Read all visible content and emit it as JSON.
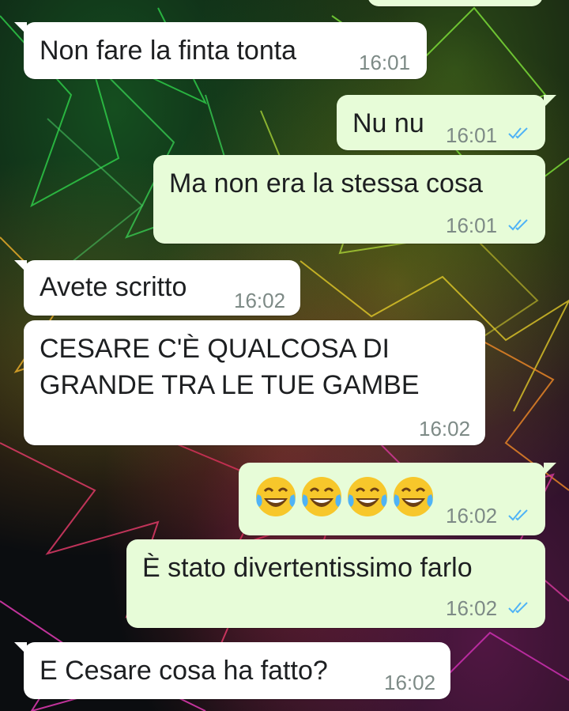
{
  "messages": [
    {
      "text": "Non fare la finta tonta",
      "time": "16:01",
      "dir": "in"
    },
    {
      "text": "Nu nu",
      "time": "16:01",
      "dir": "out",
      "read": true
    },
    {
      "text": "Ma non era la stessa cosa",
      "time": "16:01",
      "dir": "out",
      "read": true
    },
    {
      "text": "Avete scritto",
      "time": "16:02",
      "dir": "in"
    },
    {
      "text_line1": "CESARE C'È QUALCOSA DI",
      "text_line2": "GRANDE TRA LE TUE GAMBE",
      "time": "16:02",
      "dir": "in"
    },
    {
      "emoji": "face-with-tears-of-joy x4",
      "time": "16:02",
      "dir": "out",
      "read": true
    },
    {
      "text": "È stato divertentissimo farlo",
      "time": "16:02",
      "dir": "out",
      "read": true
    },
    {
      "text": "E Cesare cosa ha fatto?",
      "time": "16:02",
      "dir": "in"
    }
  ],
  "colors": {
    "incoming_bubble": "#ffffff",
    "outgoing_bubble": "#e7fcd8",
    "timestamp": "#7d8a86",
    "read_ticks": "#4fb3f6"
  }
}
